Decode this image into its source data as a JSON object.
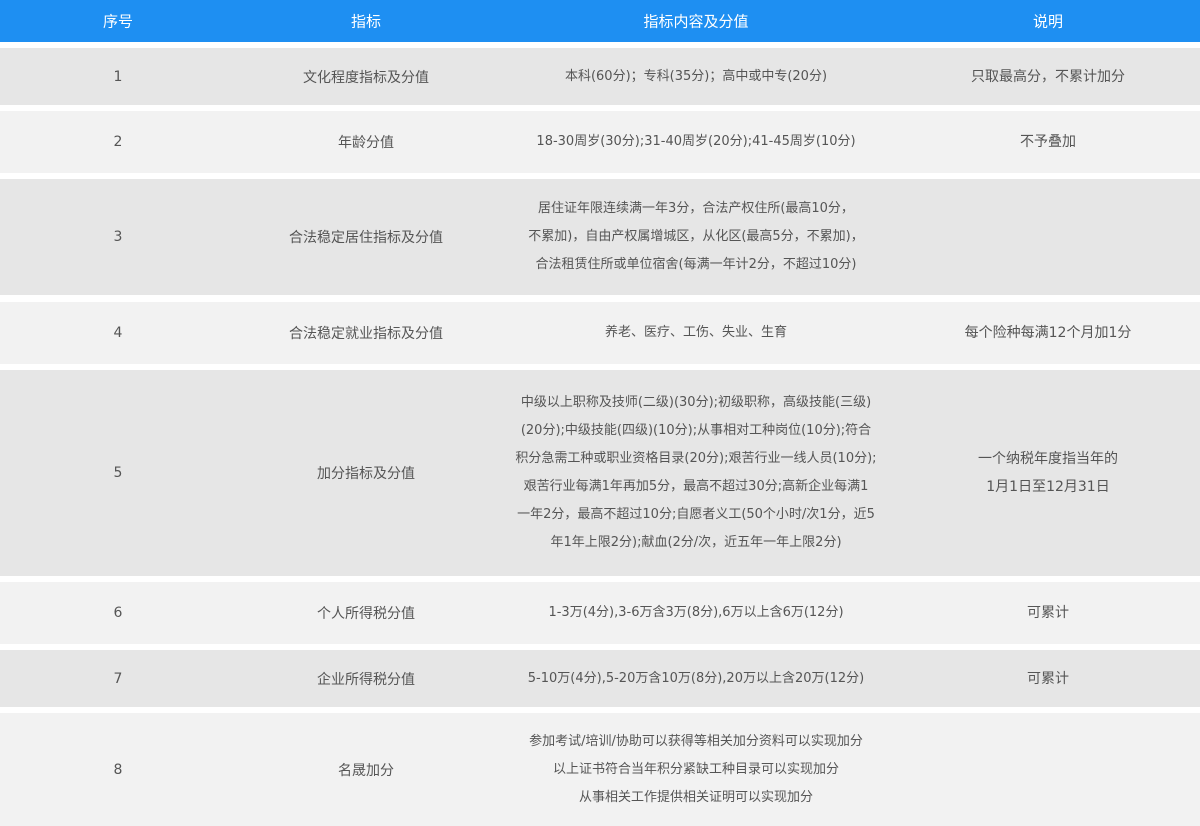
{
  "header": {
    "col1": "序号",
    "col2": "指标",
    "col3": "指标内容及分值",
    "col4": "说明"
  },
  "rows": [
    {
      "no": "1",
      "name": "文化程度指标及分值",
      "content": [
        "本科(60分)；专科(35分)；高中或中专(20分)"
      ],
      "note": [
        "只取最高分，不累计加分"
      ]
    },
    {
      "no": "2",
      "name": "年龄分值",
      "content": [
        "18-30周岁(30分);31-40周岁(20分);41-45周岁(10分)"
      ],
      "note": [
        "不予叠加"
      ]
    },
    {
      "no": "3",
      "name": "合法稳定居住指标及分值",
      "content": [
        "居住证年限连续满一年3分，合法产权住所(最高10分，",
        "不累加)，自由产权属增城区，从化区(最高5分，不累加)，",
        "合法租赁住所或单位宿舍(每满一年计2分，不超过10分)"
      ],
      "note": []
    },
    {
      "no": "4",
      "name": "合法稳定就业指标及分值",
      "content": [
        "养老、医疗、工伤、失业、生育"
      ],
      "note": [
        "每个险种每满12个月加1分"
      ]
    },
    {
      "no": "5",
      "name": "加分指标及分值",
      "content": [
        "中级以上职称及技师(二级)(30分);初级职称，高级技能(三级)",
        "(20分);中级技能(四级)(10分);从事相对工种岗位(10分);符合",
        "积分急需工种或职业资格目录(20分);艰苦行业一线人员(10分);",
        "艰苦行业每满1年再加5分，最高不超过30分;高新企业每满1",
        "一年2分，最高不超过10分;自愿者义工(50个小时/次1分，近5",
        "年1年上限2分);献血(2分/次，近五年一年上限2分)"
      ],
      "note": [
        "一个纳税年度指当年的",
        "1月1日至12月31日"
      ]
    },
    {
      "no": "6",
      "name": "个人所得税分值",
      "content": [
        "1-3万(4分),3-6万含3万(8分),6万以上含6万(12分)"
      ],
      "note": [
        "可累计"
      ]
    },
    {
      "no": "7",
      "name": "企业所得税分值",
      "content": [
        "5-10万(4分),5-20万含10万(8分),20万以上含20万(12分)"
      ],
      "note": [
        "可累计"
      ]
    },
    {
      "no": "8",
      "name": "名晟加分",
      "content": [
        "参加考试/培训/协助可以获得等相关加分资料可以实现加分",
        "以上证书符合当年积分紧缺工种目录可以实现加分",
        "从事相关工作提供相关证明可以实现加分"
      ],
      "note": []
    }
  ]
}
